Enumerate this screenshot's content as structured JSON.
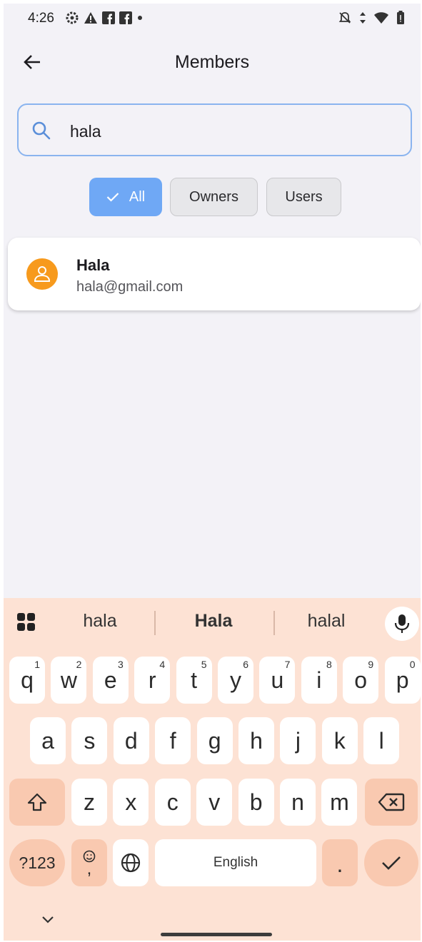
{
  "status_bar": {
    "time": "4:26",
    "left_icons": [
      "settings-gear-icon",
      "warning-icon",
      "facebook-icon",
      "facebook-icon",
      "notification-dot-icon"
    ],
    "right_icons": [
      "notifications-off-icon",
      "data-arrows-icon",
      "wifi-icon",
      "battery-icon"
    ]
  },
  "app_bar": {
    "back_icon": "arrow-left-icon",
    "title": "Members"
  },
  "search": {
    "icon": "search-icon",
    "value": "hala",
    "accent_color": "#8ab4ef"
  },
  "filters": {
    "chips": [
      {
        "label": "All",
        "selected": true
      },
      {
        "label": "Owners",
        "selected": false
      },
      {
        "label": "Users",
        "selected": false
      }
    ],
    "selected_color": "#6fa8f5"
  },
  "members": [
    {
      "name": "Hala",
      "email": "hala@gmail.com",
      "avatar_icon": "person-icon",
      "avatar_color": "#f79a1d"
    }
  ],
  "keyboard": {
    "suggestions": [
      "hala",
      "Hala",
      "halal"
    ],
    "row1": [
      {
        "key": "q",
        "num": "1"
      },
      {
        "key": "w",
        "num": "2"
      },
      {
        "key": "e",
        "num": "3"
      },
      {
        "key": "r",
        "num": "4"
      },
      {
        "key": "t",
        "num": "5"
      },
      {
        "key": "y",
        "num": "6"
      },
      {
        "key": "u",
        "num": "7"
      },
      {
        "key": "i",
        "num": "8"
      },
      {
        "key": "o",
        "num": "9"
      },
      {
        "key": "p",
        "num": "0"
      }
    ],
    "row2": [
      "a",
      "s",
      "d",
      "f",
      "g",
      "h",
      "j",
      "k",
      "l"
    ],
    "row3": [
      "z",
      "x",
      "c",
      "v",
      "b",
      "n",
      "m"
    ],
    "symbols_label": "?123",
    "emoji_label": ",",
    "space_label": "English",
    "period_label": ".",
    "background_color": "#fde2d4",
    "function_key_color": "#f9c9b0"
  }
}
